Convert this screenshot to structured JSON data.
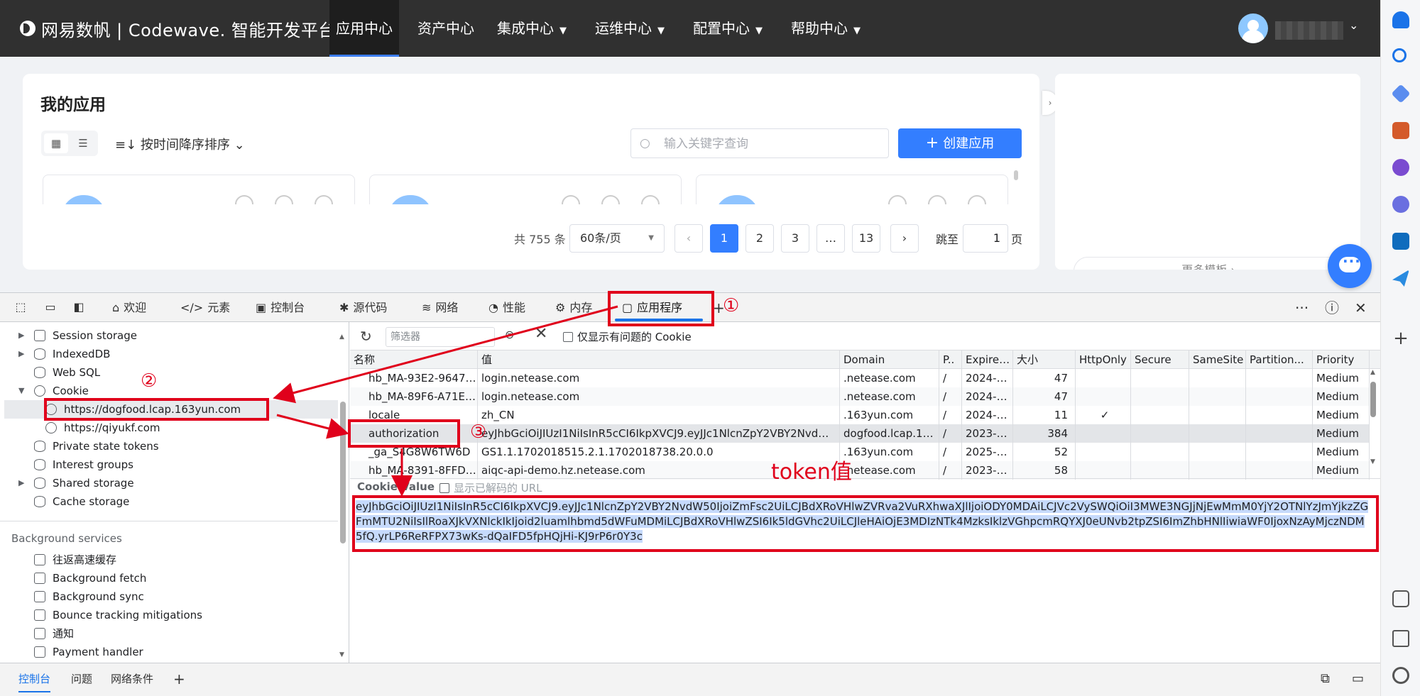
{
  "topnav": {
    "brand": "网易数帆 | Codewave. 智能开发平台",
    "items": [
      {
        "label": "应用中心",
        "dropdown": false,
        "active": true
      },
      {
        "label": "资产中心",
        "dropdown": false,
        "active": false
      },
      {
        "label": "集成中心",
        "dropdown": true,
        "active": false
      },
      {
        "label": "运维中心",
        "dropdown": true,
        "active": false
      },
      {
        "label": "配置中心",
        "dropdown": true,
        "active": false
      },
      {
        "label": "帮助中心",
        "dropdown": true,
        "active": false
      }
    ]
  },
  "main": {
    "title": "我的应用",
    "sort_label": "按时间降序排序",
    "search_placeholder": "输入关键字查询",
    "create_label": "创建应用",
    "pagination": {
      "total": "共 755 条",
      "page_size": "60条/页",
      "prev": "‹",
      "pages": [
        "1",
        "2",
        "3",
        "…",
        "13"
      ],
      "current": "1",
      "next": "›",
      "jump_label": "跳至",
      "jump_value": "1",
      "jump_unit": "页"
    },
    "more_templates": "更多模板 ›"
  },
  "devtools": {
    "tabs": [
      {
        "label": "欢迎",
        "icon": "home-icon"
      },
      {
        "label": "元素",
        "icon": "code-icon"
      },
      {
        "label": "控制台",
        "icon": "console-icon"
      },
      {
        "label": "源代码",
        "icon": "bug-icon"
      },
      {
        "label": "网络",
        "icon": "wifi-icon"
      },
      {
        "label": "性能",
        "icon": "gauge-icon"
      },
      {
        "label": "内存",
        "icon": "chip-icon"
      },
      {
        "label": "应用程序",
        "icon": "app-window-icon"
      }
    ],
    "selected_tab": "应用程序",
    "tree": {
      "items": [
        {
          "label": "Session storage",
          "arrow": "▶",
          "icon": "table"
        },
        {
          "label": "IndexedDB",
          "arrow": "▶",
          "icon": "db"
        },
        {
          "label": "Web SQL",
          "arrow": "",
          "icon": "db"
        },
        {
          "label": "Cookie",
          "arrow": "▼",
          "icon": "ck"
        },
        {
          "label": "https://dogfood.lcap.163yun.com",
          "arrow": "",
          "icon": "ck",
          "child": true,
          "selected": true
        },
        {
          "label": "https://qiyukf.com",
          "arrow": "",
          "icon": "ck",
          "child": true
        },
        {
          "label": "Private state tokens",
          "arrow": "",
          "icon": "db"
        },
        {
          "label": "Interest groups",
          "arrow": "",
          "icon": "db"
        },
        {
          "label": "Shared storage",
          "arrow": "▶",
          "icon": "db"
        },
        {
          "label": "Cache storage",
          "arrow": "",
          "icon": "db"
        }
      ],
      "section": "Background services",
      "services": [
        "往返高速缓存",
        "Background fetch",
        "Background sync",
        "Bounce tracking mitigations",
        "通知",
        "Payment handler"
      ]
    },
    "cookies": {
      "filter_placeholder": "筛选器",
      "only_issues_label": "仅显示有问题的 Cookie",
      "columns": [
        "名称",
        "值",
        "Domain",
        "P..",
        "Expires /...",
        "大小",
        "HttpOnly",
        "Secure",
        "SameSite",
        "Partition...",
        "Priority"
      ],
      "rows": [
        [
          "hb_MA-93E2-9647F...",
          "login.netease.com",
          ".netease.com",
          "/",
          "2024-01...",
          "47",
          "",
          "",
          "",
          "",
          "Medium"
        ],
        [
          "hb_MA-89F6-A71EC...",
          "login.netease.com",
          ".netease.com",
          "/",
          "2024-01...",
          "47",
          "",
          "",
          "",
          "",
          "Medium"
        ],
        [
          "locale",
          "zh_CN",
          ".163yun.com",
          "/",
          "2024-12...",
          "11",
          "✓",
          "",
          "",
          "",
          "Medium"
        ],
        [
          "authorization",
          "eyJhbGciOiJIUzI1NiIsInR5cCI6IkpXVCJ9.eyJJc1NlcnZpY2VBY2NvdW50I...",
          "dogfood.lcap.16...",
          "/",
          "2023-12...",
          "384",
          "",
          "",
          "",
          "",
          "Medium"
        ],
        [
          "_ga_S4G8W6TW6D",
          "GS1.1.1702018515.2.1.1702018738.20.0.0",
          ".163yun.com",
          "/",
          "2025-01...",
          "52",
          "",
          "",
          "",
          "",
          "Medium"
        ],
        [
          "hb_MA-8391-8FFD5...",
          "aiqc-api-demo.hz.netease.com",
          ".netease.com",
          "/",
          "2023-12...",
          "58",
          "",
          "",
          "",
          "",
          "Medium"
        ]
      ],
      "selected_row": 3,
      "cookie_value_label": "Cookie Value",
      "show_decoded_label": "显示已解码的 URL",
      "cookie_value": "eyJhbGciOiJIUzI1NiIsInR5cCI6IkpXVCJ9.eyJJc1NlcnZpY2VBY2NvdW50IjoiZmFsc2UiLCJBdXRoVHlwZVRva2VuRXhwaXJlIjoiODY0MDAiLCJVc2VySWQiOiI3MWE3NGJjNjEwMmM0YjY2OTNlYzJmYjkzZGFmMTU2NiIsIlRoaXJkVXNlckIkIjoid2luamlhbmd5dWFuMDMiLCJBdXRoVHlwZSI6Ik5ldGVhc2UiLCJleHAiOjE3MDIzNTk4MzksIklzVGhpcmRQYXJ0eUNvb2tpZSI6ImZhbHNlIiwiaWF0IjoxNzAyMjczNDM5fQ.yrLP6ReRFPX73wKs-dQaIFD5fpHQjHi-KJ9rP6r0Y3c"
    },
    "drawer_tabs": [
      "控制台",
      "问题",
      "网络条件"
    ]
  },
  "annotations": {
    "step1": "①",
    "step2": "②",
    "step3": "③",
    "token_note": "token值"
  },
  "colors": {
    "nav_bg": "#303030",
    "accent": "#337eff",
    "annotation_red": "#e0001b"
  }
}
